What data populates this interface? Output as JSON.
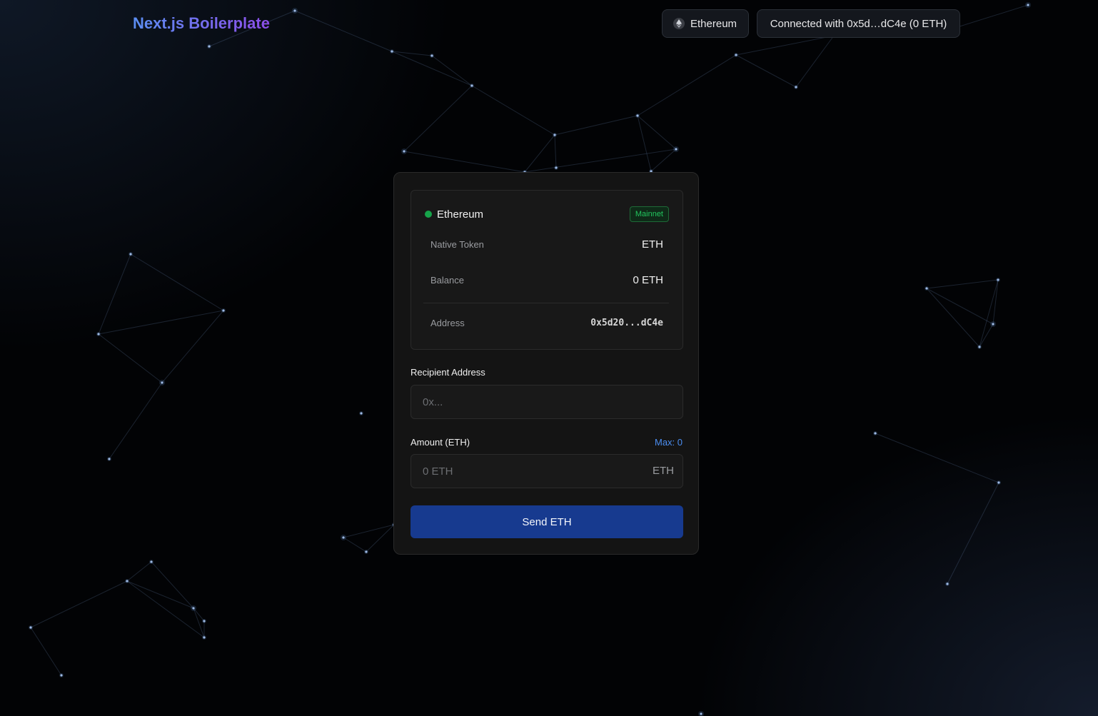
{
  "brand": {
    "title": "Next.js Boilerplate"
  },
  "header": {
    "chain_button": {
      "label": "Ethereum",
      "icon": "ethereum-icon"
    },
    "account_button": {
      "label": "Connected with 0x5d…dC4e (0 ETH)"
    }
  },
  "network_card": {
    "network_name": "Ethereum",
    "status_color": "#16a34a",
    "badge": "Mainnet",
    "rows": [
      {
        "label": "Native Token",
        "value": "ETH"
      },
      {
        "label": "Balance",
        "value": "0 ETH"
      },
      {
        "label": "Address",
        "value": "0x5d20...dC4e"
      }
    ]
  },
  "form": {
    "recipient": {
      "label": "Recipient Address",
      "placeholder": "0x...",
      "value": ""
    },
    "amount": {
      "label": "Amount (ETH)",
      "max_label": "Max: 0",
      "placeholder": "0 ETH",
      "value": "",
      "suffix": "ETH"
    },
    "submit_label": "Send ETH"
  },
  "colors": {
    "accent": "#4b8df0",
    "button": "#173a8f",
    "brand_gradient_start": "#5b8ff3",
    "brand_gradient_end": "#8c4de8"
  }
}
